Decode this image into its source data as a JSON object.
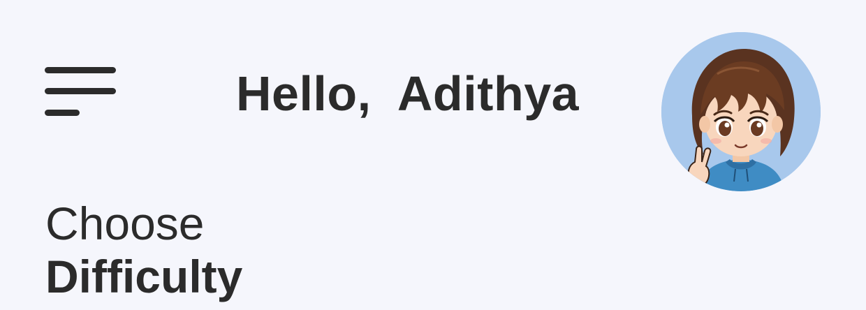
{
  "header": {
    "greeting": "Hello,  Adithya",
    "menu_icon": "hamburger-menu-icon",
    "avatar_icon": "cartoon-avatar"
  },
  "main": {
    "heading_line1": "Choose",
    "heading_line2": "Difficulty"
  },
  "colors": {
    "background": "#f5f6fc",
    "text": "#2b2b2b",
    "avatar_background": "#a8c8ec"
  }
}
